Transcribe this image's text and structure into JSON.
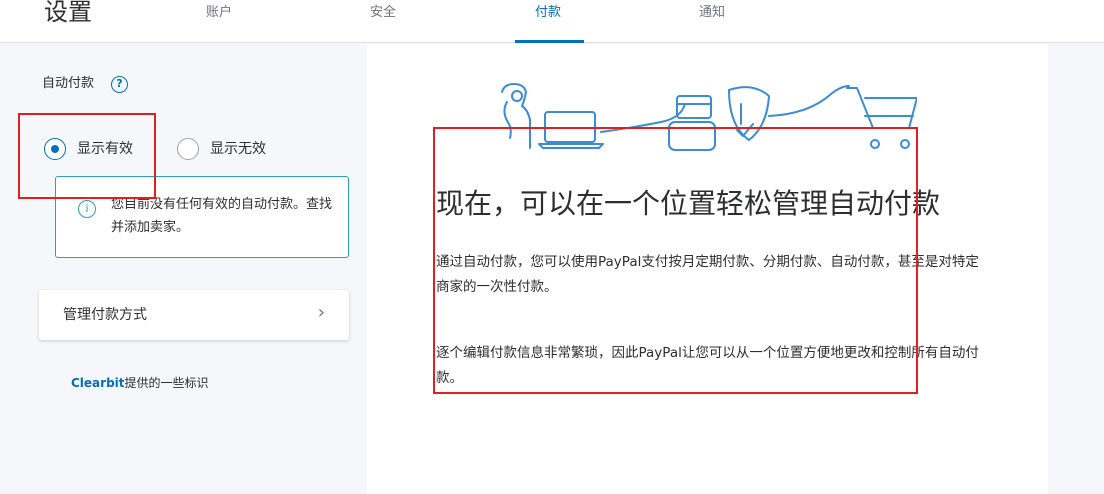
{
  "header": {
    "title": "设置",
    "tabs": [
      {
        "label": "账户"
      },
      {
        "label": "安全"
      },
      {
        "label": "付款"
      },
      {
        "label": "通知"
      }
    ],
    "active_tab": "付款"
  },
  "sidebar": {
    "autopay_label": "自动付款",
    "help_symbol": "?",
    "radio_active_label": "显示有效",
    "radio_inactive_label": "显示无效",
    "selected": "显示有效",
    "info_symbol": "i",
    "info_text": "您目前没有任何有效的自动付款。查找并添加卖家。",
    "manage_label": "管理付款方式",
    "manage_chevron": "›",
    "clearbit_brand": "Clearbit",
    "clearbit_suffix": "提供的一些标识"
  },
  "main": {
    "headline": "现在，可以在一个位置轻松管理自动付款",
    "paragraph1": "通过自动付款，您可以使用PayPal支付按月定期付款、分期付款、自动付款，甚至是对特定商家的一次性付款。",
    "paragraph2": "逐个编辑付款信息非常繁琐，因此PayPal让您可以从一个位置方便地更改和控制所有自动付款。"
  },
  "colors": {
    "accent": "#0070ba",
    "info_border": "#2ba0b6",
    "highlight": "#e02020",
    "illustration_stroke": "#3d8bd0"
  }
}
